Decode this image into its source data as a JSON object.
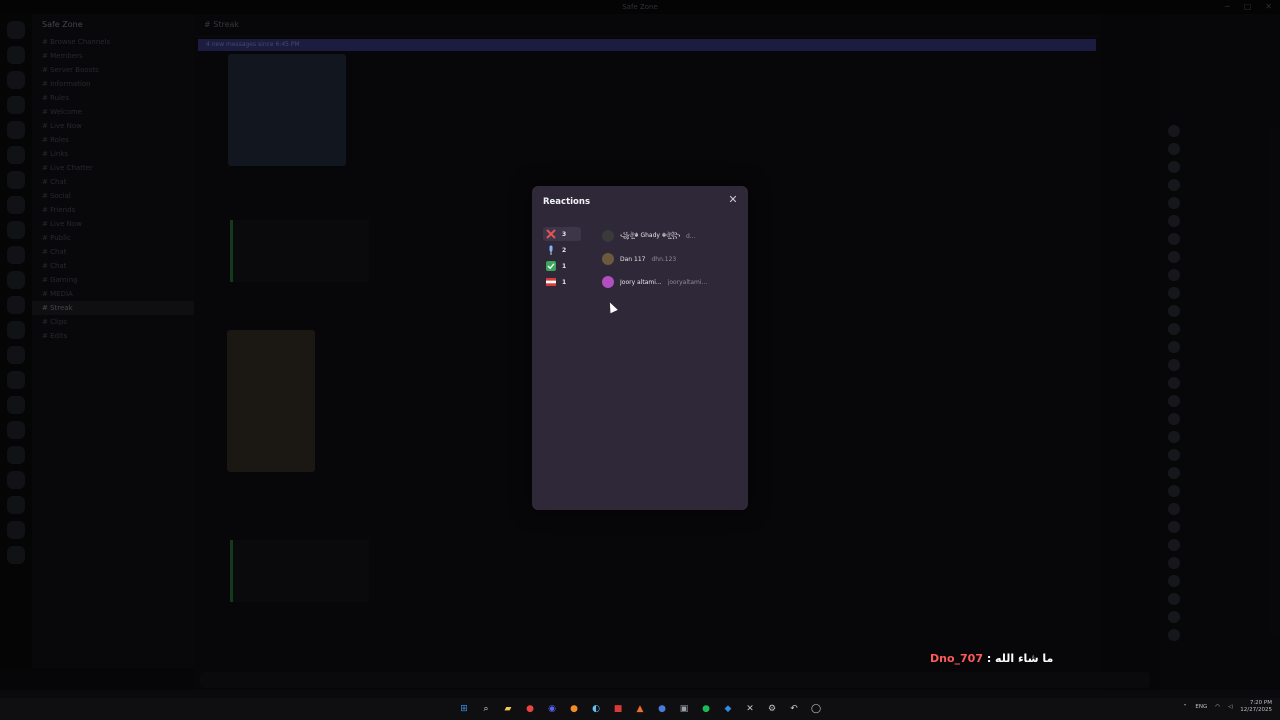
{
  "window": {
    "title": "Safe Zone"
  },
  "server": {
    "name": "Safe Zone"
  },
  "channel": {
    "name": "Streak",
    "new_messages": "4 new messages since 6:45 PM"
  },
  "sidebar": {
    "items": [
      "Browse Channels",
      "Members",
      "Server Boosts",
      "Information",
      "Rules",
      "Welcome",
      "Live Now",
      "Roles",
      "Links",
      "Live Chatter",
      "Chat",
      "Social",
      "Friends",
      "Live Now",
      "Public",
      "Chat",
      "Chat",
      "Gaming",
      "MEDIA",
      "Streak",
      "Clips",
      "Edits"
    ],
    "selected_index": 19
  },
  "modal": {
    "title": "Reactions",
    "reactions": [
      {
        "emoji": "cross-mark",
        "count": "3",
        "color": "#e05555"
      },
      {
        "emoji": "pin",
        "count": "2",
        "color": "#7fb6ff"
      },
      {
        "emoji": "check-mark",
        "count": "1",
        "color": "#3ba55c"
      },
      {
        "emoji": "flag",
        "count": "1",
        "color": "#e0e0e0"
      }
    ],
    "users": [
      {
        "display": "꧁ঔৣ☬ Ghady ☬ঔৣ꧂",
        "username": "d...",
        "avatar_color": "#3a3a3a"
      },
      {
        "display": "Dan 117",
        "username": "dhn.123",
        "avatar_color": "#6b5a3e"
      },
      {
        "display": "Joory altami...",
        "username": "jooryaltami...",
        "avatar_color": "#b050c0"
      }
    ]
  },
  "caption": {
    "user": "Dno_707",
    "separator": " : ",
    "message": "ما شاء الله"
  },
  "taskbar": {
    "icons": [
      {
        "name": "windows-start-icon",
        "glyph": "⊞",
        "color": "#3b8eea"
      },
      {
        "name": "search-icon",
        "glyph": "⌕",
        "color": "#dddddd"
      },
      {
        "name": "file-explorer-icon",
        "glyph": "▰",
        "color": "#f2c94c"
      },
      {
        "name": "chrome-icon",
        "glyph": "●",
        "color": "#e8453c"
      },
      {
        "name": "discord-icon",
        "glyph": "◉",
        "color": "#5865f2"
      },
      {
        "name": "app-icon-orange",
        "glyph": "●",
        "color": "#f28c28"
      },
      {
        "name": "steam-icon",
        "glyph": "◐",
        "color": "#66c0f4"
      },
      {
        "name": "app-icon-red",
        "glyph": "■",
        "color": "#d83a3a"
      },
      {
        "name": "app-icon-triangle",
        "glyph": "▲",
        "color": "#f06d2c"
      },
      {
        "name": "app-icon-blue",
        "glyph": "●",
        "color": "#4a7bd9"
      },
      {
        "name": "app-icon-code",
        "glyph": "▣",
        "color": "#9aa0a6"
      },
      {
        "name": "spotify-icon",
        "glyph": "●",
        "color": "#1db954"
      },
      {
        "name": "app-icon-blue2",
        "glyph": "◆",
        "color": "#2f8ae0"
      },
      {
        "name": "app-icon-x",
        "glyph": "✕",
        "color": "#c7c7c7"
      },
      {
        "name": "app-icon-gear",
        "glyph": "⚙",
        "color": "#c7c7c7"
      },
      {
        "name": "app-icon-back",
        "glyph": "↶",
        "color": "#c7c7c7"
      },
      {
        "name": "app-icon-circle",
        "glyph": "◯",
        "color": "#c7c7c7"
      }
    ],
    "lang": "ENG",
    "time": "7:20 PM",
    "date": "12/27/2025"
  }
}
